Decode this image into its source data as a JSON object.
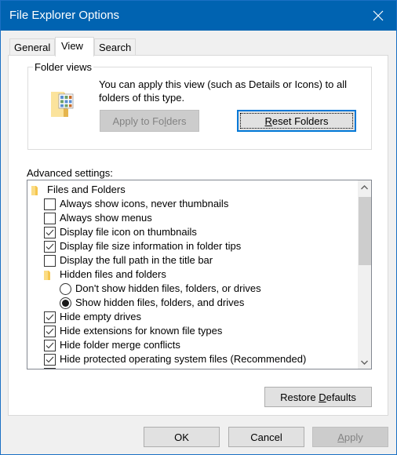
{
  "window": {
    "title": "File Explorer Options",
    "accent_color": "#0063b1"
  },
  "tabs": [
    {
      "label": "General",
      "active": false
    },
    {
      "label": "View",
      "active": true
    },
    {
      "label": "Search",
      "active": false
    }
  ],
  "folder_views": {
    "legend": "Folder views",
    "description": "You can apply this view (such as Details or Icons) to all folders of this type.",
    "apply_button": {
      "pre": "Apply to Fo",
      "mnemonic": "l",
      "post": "ders",
      "disabled": true
    },
    "reset_button": {
      "pre": "",
      "mnemonic": "R",
      "post": "eset Folders",
      "focused": true
    }
  },
  "advanced": {
    "label": "Advanced settings:",
    "items": [
      {
        "type": "folder",
        "level": 0,
        "label": "Files and Folders"
      },
      {
        "type": "checkbox",
        "level": 1,
        "label": "Always show icons, never thumbnails",
        "checked": false
      },
      {
        "type": "checkbox",
        "level": 1,
        "label": "Always show menus",
        "checked": false
      },
      {
        "type": "checkbox",
        "level": 1,
        "label": "Display file icon on thumbnails",
        "checked": true
      },
      {
        "type": "checkbox",
        "level": 1,
        "label": "Display file size information in folder tips",
        "checked": true
      },
      {
        "type": "checkbox",
        "level": 1,
        "label": "Display the full path in the title bar",
        "checked": false
      },
      {
        "type": "folder",
        "level": 1,
        "label": "Hidden files and folders"
      },
      {
        "type": "radio",
        "level": 2,
        "label": "Don't show hidden files, folders, or drives",
        "checked": false
      },
      {
        "type": "radio",
        "level": 2,
        "label": "Show hidden files, folders, and drives",
        "checked": true
      },
      {
        "type": "checkbox",
        "level": 1,
        "label": "Hide empty drives",
        "checked": true
      },
      {
        "type": "checkbox",
        "level": 1,
        "label": "Hide extensions for known file types",
        "checked": true
      },
      {
        "type": "checkbox",
        "level": 1,
        "label": "Hide folder merge conflicts",
        "checked": true
      },
      {
        "type": "checkbox",
        "level": 1,
        "label": "Hide protected operating system files (Recommended)",
        "checked": true
      }
    ],
    "scroll_position_percent": 0
  },
  "restore_button": {
    "pre": "Restore ",
    "mnemonic": "D",
    "post": "efaults"
  },
  "footer": {
    "ok": "OK",
    "cancel": "Cancel",
    "apply": {
      "pre": "",
      "mnemonic": "A",
      "post": "pply",
      "disabled": true
    }
  }
}
